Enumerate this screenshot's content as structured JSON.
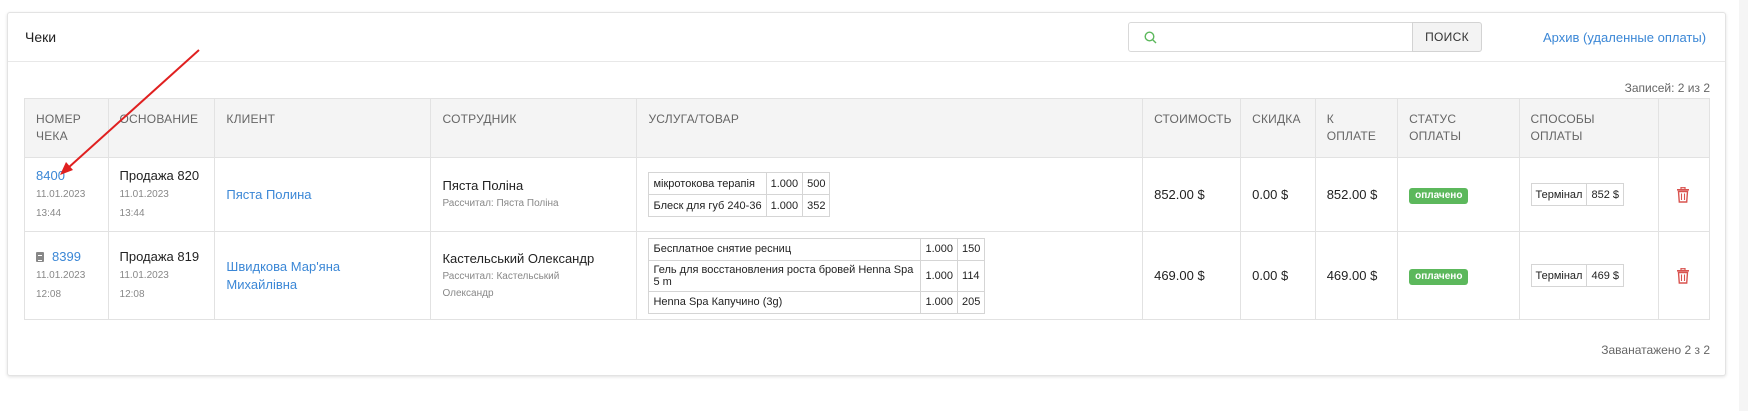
{
  "header": {
    "title": "Чеки",
    "search_placeholder": "",
    "search_button": "ПОИСК",
    "archive_link": "Архив (удаленные оплаты)"
  },
  "records_count": "Записей: 2 из 2",
  "footer_count": "Заванатажено 2 з 2",
  "columns": {
    "number": [
      "НОМЕР",
      "ЧЕКА"
    ],
    "basis": "ОСНОВАНИЕ",
    "client": "КЛИЕНТ",
    "employee": "СОТРУДНИК",
    "service": "УСЛУГА/ТОВАР",
    "cost": "СТОИМОСТЬ",
    "discount": "СКИДКА",
    "to_pay": [
      "К",
      "ОПЛАТЕ"
    ],
    "status": [
      "СТАТУС",
      "ОПЛАТЫ"
    ],
    "methods": [
      "СПОСОБЫ",
      "ОПЛАТЫ"
    ]
  },
  "rows": [
    {
      "number": "8400",
      "date": "11.01.2023",
      "time": "13:44",
      "basis": "Продажа 820",
      "basis_date": "11.01.2023",
      "basis_time": "13:44",
      "client": "Пяста Полина",
      "client_line2": "",
      "employee": "Пяста Поліна",
      "employee_sub": "Рассчитал: Пяста Поліна",
      "employee_sub2": "",
      "items": [
        {
          "name": "мікротокова терапія",
          "qty": "1.000",
          "price": "500"
        },
        {
          "name": "Блеск для губ 240-36",
          "qty": "1.000",
          "price": "352"
        }
      ],
      "cost": "852.00 $",
      "discount": "0.00 $",
      "to_pay": "852.00 $",
      "status": "оплачено",
      "payment": {
        "method": "Термінал",
        "amount": "852 $"
      }
    },
    {
      "number": "8399",
      "date": "11.01.2023",
      "time": "12:08",
      "basis": "Продажа 819",
      "basis_date": "11.01.2023",
      "basis_time": "12:08",
      "client": "Швидкова Мар'яна",
      "client_line2": "Михайлівна",
      "employee": "Кастельський Олександр",
      "employee_sub": "Рассчитал: Кастельський",
      "employee_sub2": "Олександр",
      "items": [
        {
          "name": "Бесплатное снятие ресниц",
          "qty": "1.000",
          "price": "150"
        },
        {
          "name": "Гель для восстановления роста бровей Henna Spa 5 m",
          "qty": "1.000",
          "price": "114"
        },
        {
          "name": "Henna Spa Капучино (3g)",
          "qty": "1.000",
          "price": "205"
        }
      ],
      "cost": "469.00 $",
      "discount": "0.00 $",
      "to_pay": "469.00 $",
      "status": "оплачено",
      "payment": {
        "method": "Термінал",
        "amount": "469 $"
      }
    }
  ],
  "colors": {
    "link": "#3b87d6",
    "status_paid": "#5cb85c",
    "delete": "#d9534f",
    "annotation_arrow": "#e02020"
  }
}
